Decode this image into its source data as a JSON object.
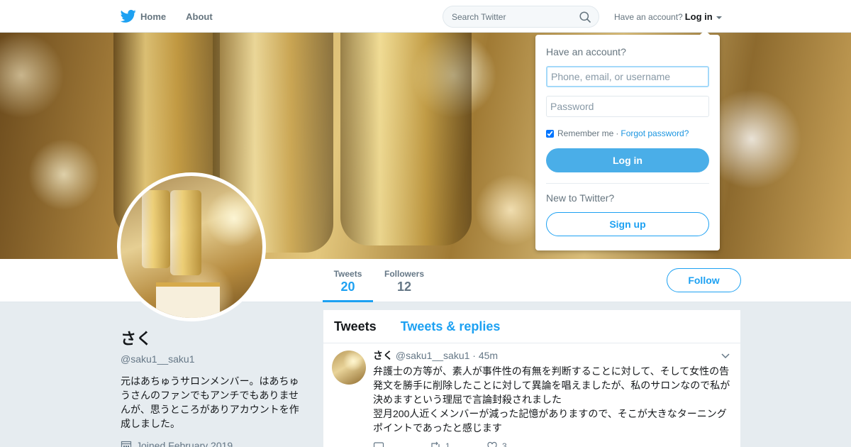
{
  "nav": {
    "home_label": "Home",
    "about_label": "About",
    "search_placeholder": "Search Twitter",
    "have_account": "Have an account?",
    "login_label": "Log in"
  },
  "profile_nav": {
    "tweets_label": "Tweets",
    "tweets_count": "20",
    "followers_label": "Followers",
    "followers_count": "12",
    "follow_label": "Follow"
  },
  "profile": {
    "name": "さく",
    "handle": "@saku1__saku1",
    "bio": "元はあちゅうサロンメンバー。はあちゅうさんのファンでもアンチでもありませんが、思うところがありアカウントを作成しました。",
    "joined": "Joined February 2019"
  },
  "timeline": {
    "tab_tweets": "Tweets",
    "tab_replies": "Tweets & replies",
    "tweet": {
      "name": "さく",
      "handle": "@saku1__saku1",
      "sep": "·",
      "time": "45m",
      "text": "弁護士の方等が、素人が事件性の有無を判断することに対して、そして女性の告発文を勝手に削除したことに対して異論を唱えましたが、私のサロンなので私が決めますという理屈で言論封殺されました\n翌月200人近くメンバーが減った記憶がありますので、そこが大きなターニングポイントであったと感じます",
      "retweets": "1",
      "likes": "3"
    }
  },
  "login_dropdown": {
    "title": "Have an account?",
    "username_placeholder": "Phone, email, or username",
    "password_placeholder": "Password",
    "remember_label": "Remember me",
    "dot": "·",
    "forgot_label": "Forgot password?",
    "login_button": "Log in",
    "new_prompt": "New to Twitter?",
    "signup_button": "Sign up"
  },
  "colors": {
    "accent": "#1da1f2",
    "login_button_bg": "#4aaee8",
    "page_bg": "#e6ecf0"
  },
  "icons": [
    "twitter-bird-icon",
    "search-icon",
    "caret-down-icon",
    "calendar-icon",
    "reply-icon",
    "retweet-icon",
    "heart-icon",
    "chevron-down-icon"
  ]
}
